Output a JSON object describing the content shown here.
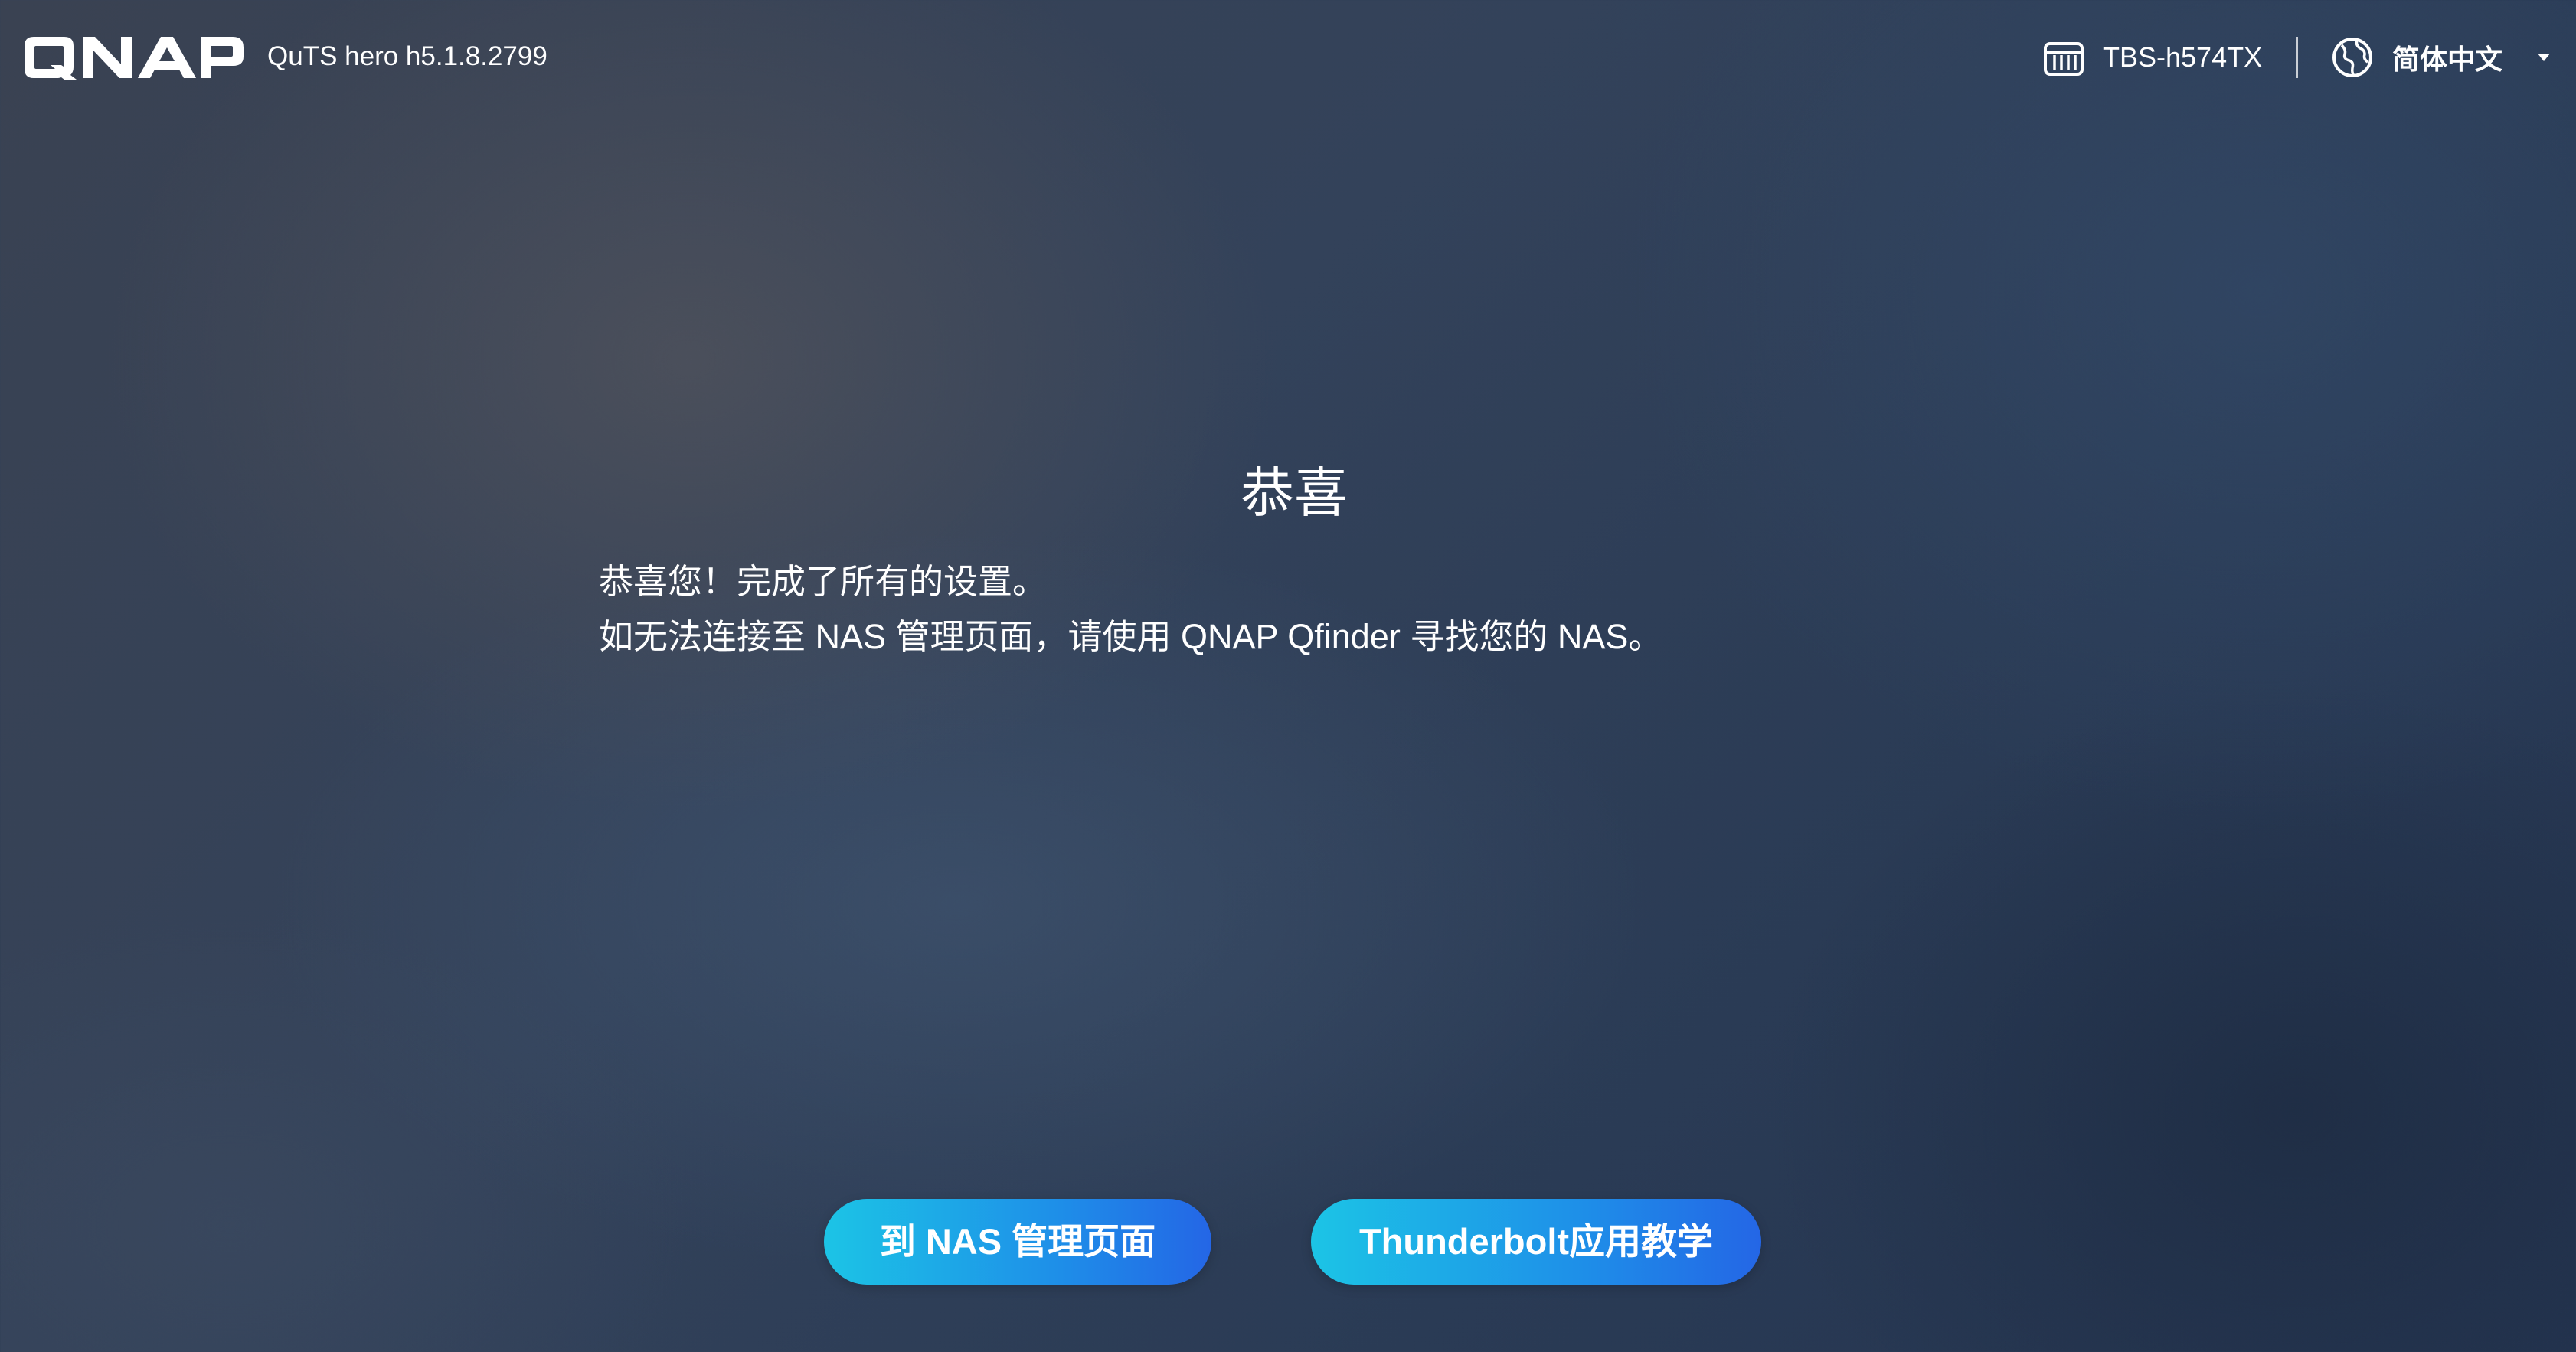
{
  "header": {
    "logo_text": "QNAP",
    "version": "QuTS hero h5.1.8.2799",
    "device_icon": "nas-device-icon",
    "device_name": "TBS-h574TX",
    "language_icon": "globe-icon",
    "language": "简体中文",
    "language_caret": "caret-down-icon"
  },
  "main": {
    "title": "恭喜",
    "message_line1": "恭喜您！完成了所有的设置。",
    "message_line2": "如无法连接至 NAS 管理页面，请使用 QNAP Qfinder 寻找您的 NAS。"
  },
  "actions": {
    "manage_label": "到 NAS 管理页面",
    "thunderbolt_label": "Thunderbolt应用教学"
  },
  "colors": {
    "button_gradient_start": "#1cc4e6",
    "button_gradient_end": "#2466e6",
    "text": "#ffffff"
  }
}
